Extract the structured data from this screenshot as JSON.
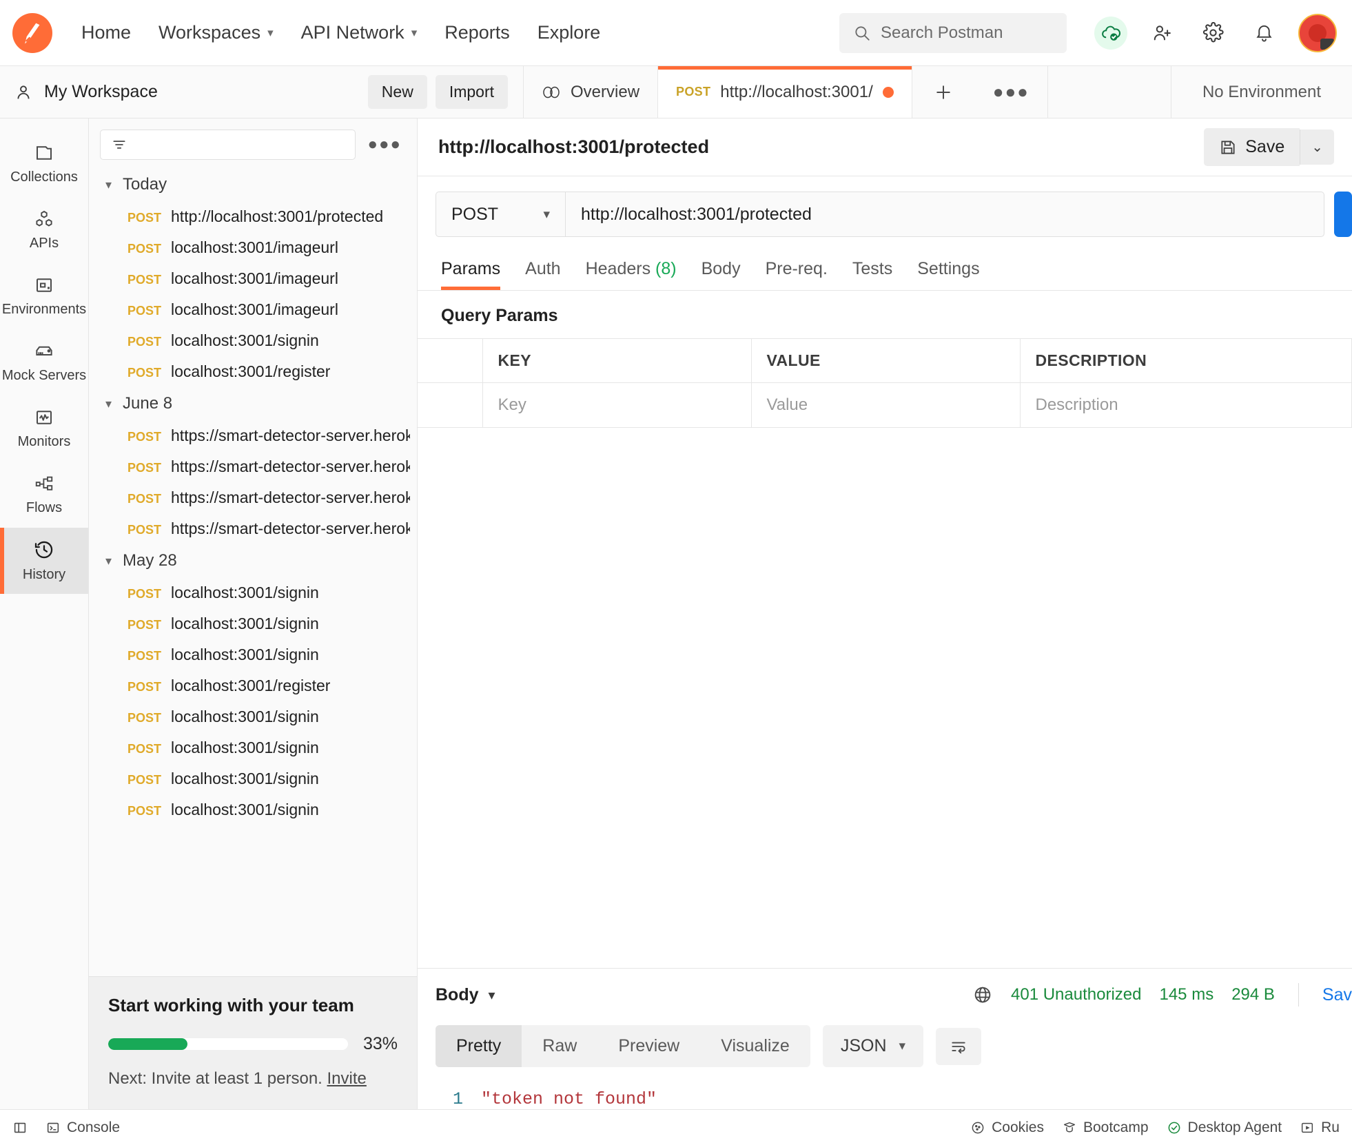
{
  "topnav": {
    "logo_icon": "postman-logo-icon",
    "links": [
      {
        "label": "Home",
        "has_caret": false
      },
      {
        "label": "Workspaces",
        "has_caret": true
      },
      {
        "label": "API Network",
        "has_caret": true
      },
      {
        "label": "Reports",
        "has_caret": false
      },
      {
        "label": "Explore",
        "has_caret": false
      }
    ],
    "search_placeholder": "Search Postman",
    "icons": [
      "cloud-sync-icon",
      "invite-user-icon",
      "gear-icon",
      "bell-icon",
      "avatar-icon"
    ]
  },
  "workspace": {
    "name": "My Workspace",
    "user_icon": "user-icon",
    "new_label": "New",
    "import_label": "Import"
  },
  "tabs": {
    "overview_label": "Overview",
    "overview_icon": "overview-icon",
    "request_tab": {
      "method": "POST",
      "title": "http://localhost:3001/",
      "unsaved": true
    },
    "add_label": "+",
    "more_label": "●●●",
    "environment": "No Environment"
  },
  "rail": {
    "items": [
      {
        "label": "Collections",
        "icon": "collections-icon",
        "active": false
      },
      {
        "label": "APIs",
        "icon": "apis-icon",
        "active": false
      },
      {
        "label": "Environments",
        "icon": "environments-icon",
        "active": false
      },
      {
        "label": "Mock Servers",
        "icon": "mock-servers-icon",
        "active": false
      },
      {
        "label": "Monitors",
        "icon": "monitors-icon",
        "active": false
      },
      {
        "label": "Flows",
        "icon": "flows-icon",
        "active": false
      },
      {
        "label": "History",
        "icon": "history-icon",
        "active": true
      }
    ]
  },
  "sidebar": {
    "filter_icon": "filter-icon",
    "filter_placeholder": "",
    "more_label": "●●●",
    "groups": [
      {
        "label": "Today",
        "items": [
          {
            "method": "POST",
            "url": "http://localhost:3001/protected"
          },
          {
            "method": "POST",
            "url": "localhost:3001/imageurl"
          },
          {
            "method": "POST",
            "url": "localhost:3001/imageurl"
          },
          {
            "method": "POST",
            "url": "localhost:3001/imageurl"
          },
          {
            "method": "POST",
            "url": "localhost:3001/signin"
          },
          {
            "method": "POST",
            "url": "localhost:3001/register"
          }
        ]
      },
      {
        "label": "June 8",
        "items": [
          {
            "method": "POST",
            "url": "https://smart-detector-server.herokuap"
          },
          {
            "method": "POST",
            "url": "https://smart-detector-server.herokuap"
          },
          {
            "method": "POST",
            "url": "https://smart-detector-server.herokuap"
          },
          {
            "method": "POST",
            "url": "https://smart-detector-server.herokuap"
          }
        ]
      },
      {
        "label": "May 28",
        "items": [
          {
            "method": "POST",
            "url": "localhost:3001/signin"
          },
          {
            "method": "POST",
            "url": "localhost:3001/signin"
          },
          {
            "method": "POST",
            "url": "localhost:3001/signin"
          },
          {
            "method": "POST",
            "url": "localhost:3001/register"
          },
          {
            "method": "POST",
            "url": "localhost:3001/signin"
          },
          {
            "method": "POST",
            "url": "localhost:3001/signin"
          },
          {
            "method": "POST",
            "url": "localhost:3001/signin"
          },
          {
            "method": "POST",
            "url": "localhost:3001/signin"
          }
        ]
      }
    ]
  },
  "team_card": {
    "title": "Start working with your team",
    "progress_percent": 33,
    "progress_label": "33%",
    "next_text": "Next: Invite at least 1 person.",
    "invite_label": "Invite",
    "progress_color": "#18a957"
  },
  "request": {
    "title": "http://localhost:3001/protected",
    "save_label": "Save",
    "save_icon": "save-icon",
    "save_caret": "⌄",
    "method": "POST",
    "url": "http://localhost:3001/protected",
    "send_color": "#1477e8",
    "tabs": [
      {
        "label": "Params",
        "active": true,
        "count": null
      },
      {
        "label": "Auth",
        "active": false,
        "count": null
      },
      {
        "label": "Headers",
        "active": false,
        "count": "(8)"
      },
      {
        "label": "Body",
        "active": false,
        "count": null
      },
      {
        "label": "Pre-req.",
        "active": false,
        "count": null
      },
      {
        "label": "Tests",
        "active": false,
        "count": null
      },
      {
        "label": "Settings",
        "active": false,
        "count": null
      }
    ],
    "query_params_label": "Query Params",
    "table": {
      "headers": [
        "KEY",
        "VALUE",
        "DESCRIPTION"
      ],
      "rows": [
        {
          "key": "Key",
          "value": "Value",
          "description": "Description"
        }
      ]
    }
  },
  "response": {
    "body_label": "Body",
    "caret": "⌄",
    "globe_icon": "globe-icon",
    "status": "401 Unauthorized",
    "time": "145 ms",
    "size": "294 B",
    "save_label": "Sav",
    "status_color": "#1a8a3c",
    "view_tabs": [
      {
        "label": "Pretty",
        "active": true
      },
      {
        "label": "Raw",
        "active": false
      },
      {
        "label": "Preview",
        "active": false
      },
      {
        "label": "Visualize",
        "active": false
      }
    ],
    "format": "JSON",
    "format_caret": "⌄",
    "wrap_icon": "wrap-lines-icon",
    "code": [
      {
        "num": "1",
        "text": "\"token not found\""
      }
    ]
  },
  "statusbar": {
    "left": [
      {
        "label": "",
        "icon": "sidebar-toggle-icon"
      },
      {
        "label": "Console",
        "icon": "console-icon"
      }
    ],
    "right": [
      {
        "label": "Cookies",
        "icon": "cookies-icon"
      },
      {
        "label": "Bootcamp",
        "icon": "bootcamp-icon"
      },
      {
        "label": "Desktop Agent",
        "icon": "desktop-agent-icon"
      },
      {
        "label": "Ru",
        "icon": "runner-icon"
      }
    ]
  }
}
